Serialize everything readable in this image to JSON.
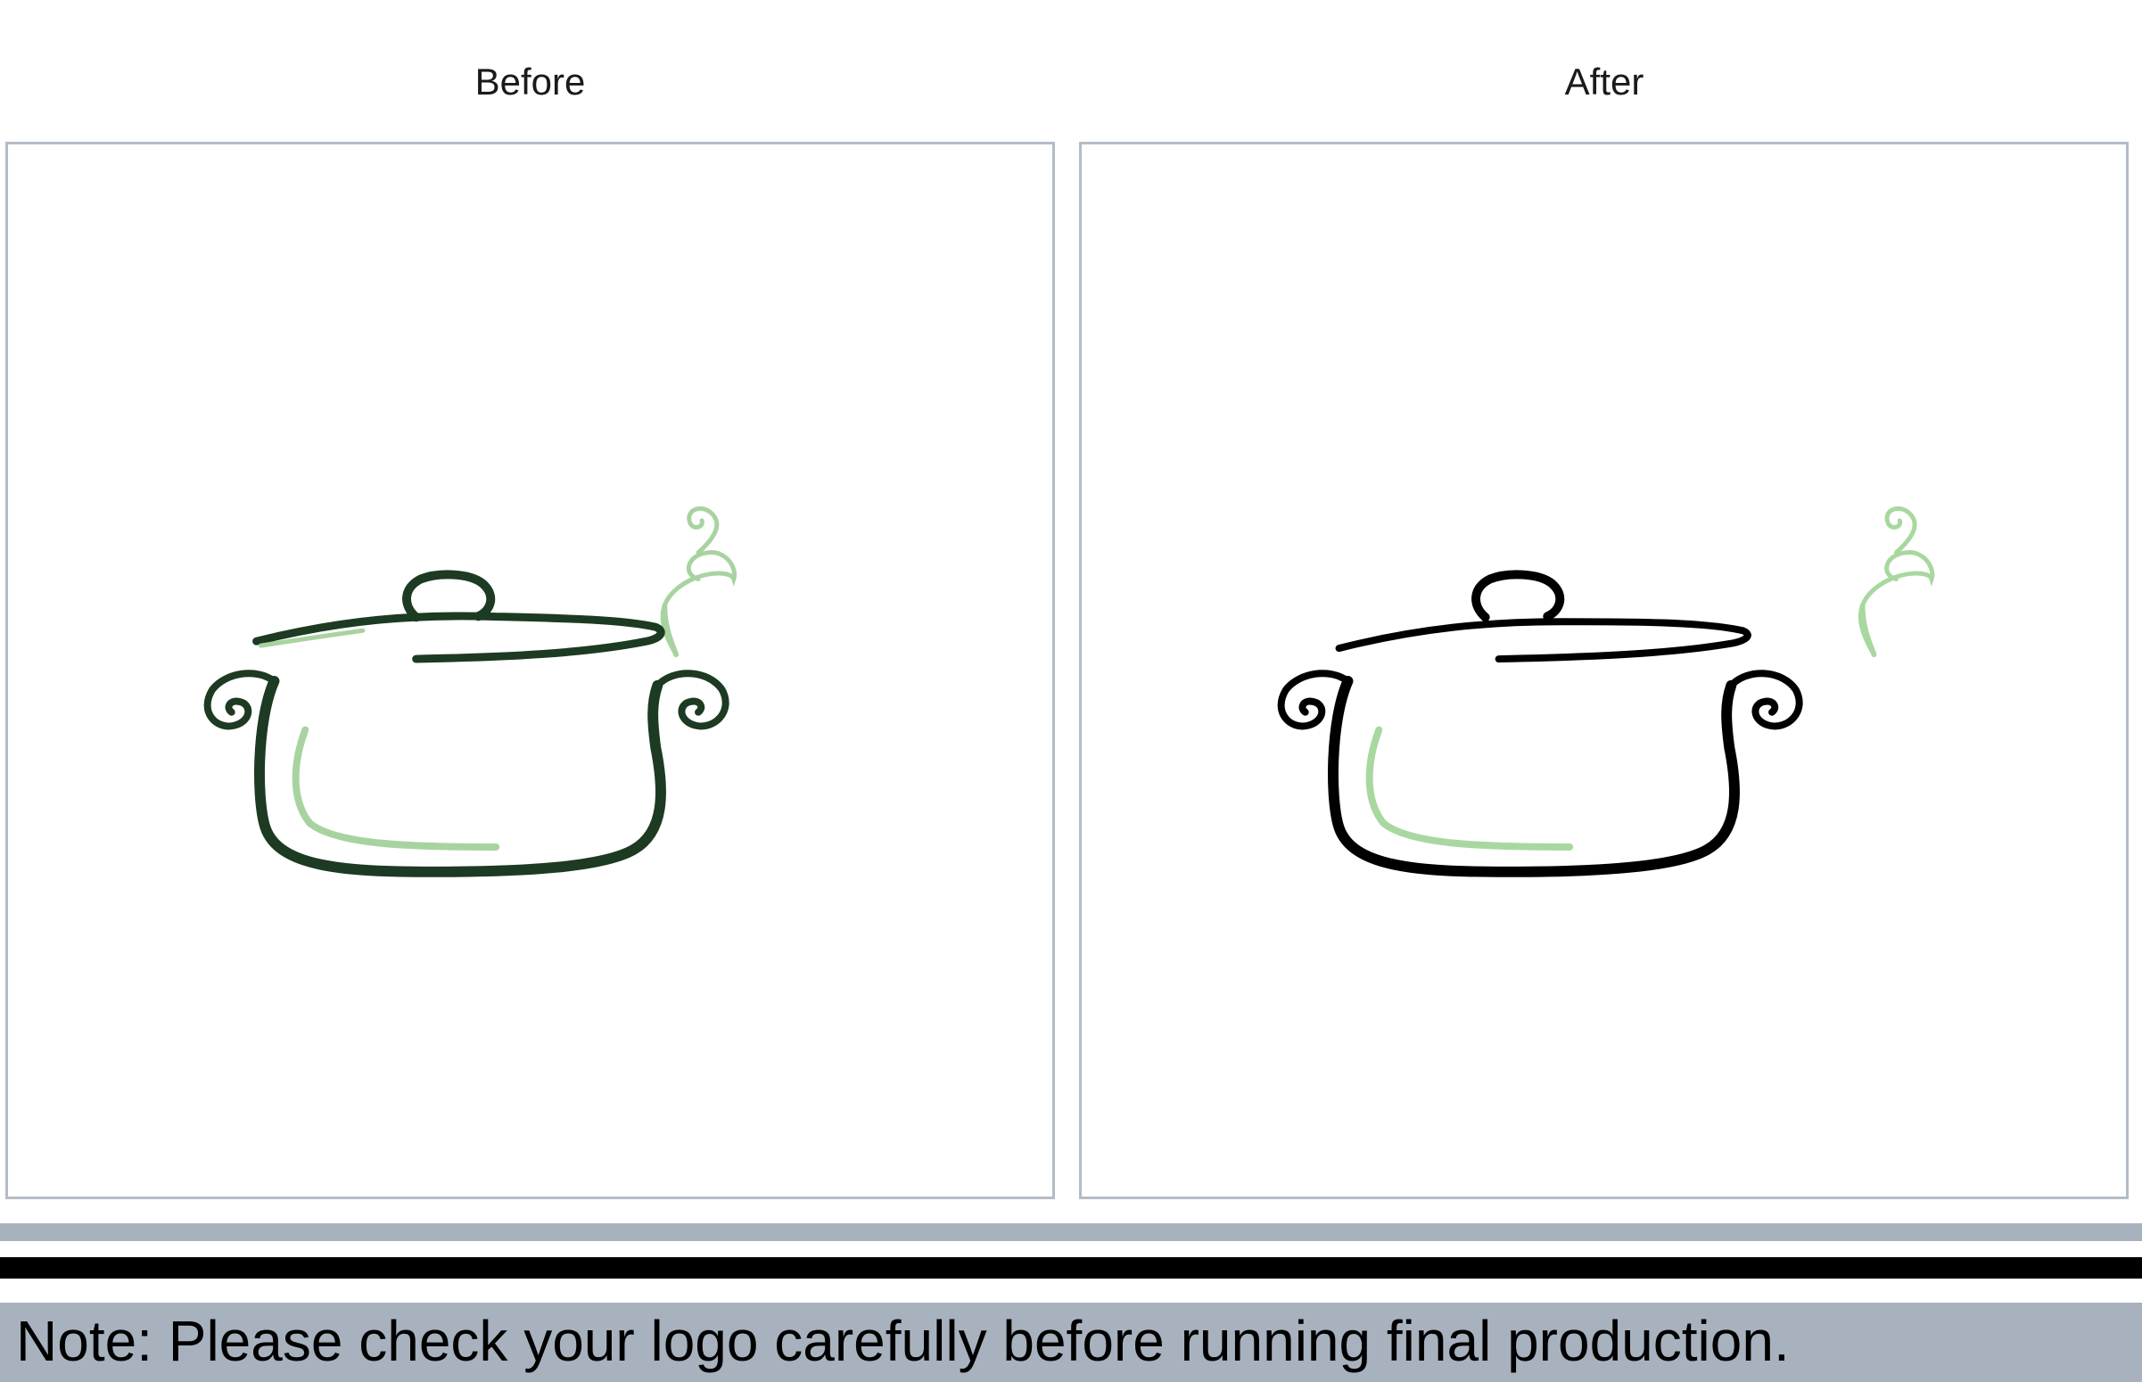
{
  "panels": {
    "before": {
      "title": "Before",
      "line_color": "#1d3a22",
      "accent_color": "#a8d3a0"
    },
    "after": {
      "title": "After",
      "line_color": "#000000",
      "accent_color": "#a8d8a0"
    }
  },
  "footer": {
    "note": "Note: Please check your logo carefully before running final production.",
    "bar_color": "#a8b2bf",
    "black_stripe_color": "#000000"
  },
  "colors": {
    "panel_border": "#b4bcc6",
    "background": "#ffffff"
  },
  "icons": {
    "logo": "cooking-pot-steam-logo"
  }
}
